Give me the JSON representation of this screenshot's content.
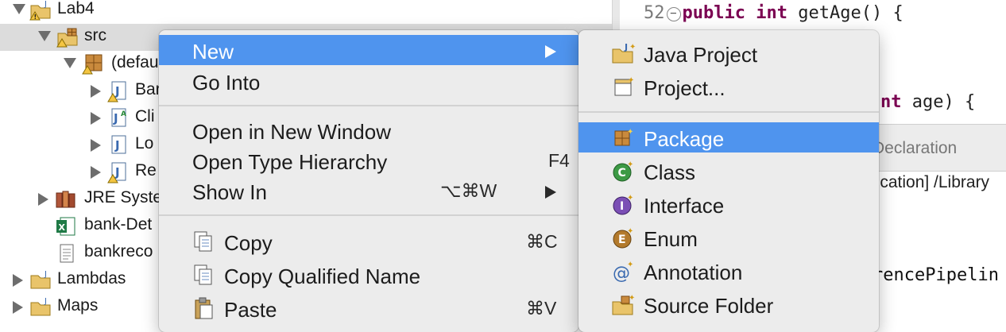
{
  "tree": {
    "items": [
      {
        "label": "Lab4"
      },
      {
        "label": "src"
      },
      {
        "label": "(defau"
      },
      {
        "label": "Bar"
      },
      {
        "label": "Cli"
      },
      {
        "label": "Lo"
      },
      {
        "label": "Re"
      },
      {
        "label": "JRE Syste"
      },
      {
        "label": "bank-Det"
      },
      {
        "label": "bankreco"
      },
      {
        "label": "Lambdas"
      },
      {
        "label": "Maps"
      }
    ]
  },
  "editor": {
    "line_number": "52",
    "line1_kw1": "public",
    "line1_kw2": "int",
    "line1_rest": "getAge() {",
    "line2_kw": "nt",
    "line2_rest": "age) {",
    "declaration_tab": "Declaration",
    "console_line": "lication] /Library",
    "code_fragment": "rencePipelin"
  },
  "context_menu": {
    "new_label": "New",
    "go_into_label": "Go Into",
    "open_new_window_label": "Open in New Window",
    "open_type_hierarchy_label": "Open Type Hierarchy",
    "open_type_hierarchy_shortcut": "F4",
    "show_in_label": "Show In",
    "show_in_shortcut": "⌥⌘W",
    "copy_label": "Copy",
    "copy_shortcut": "⌘C",
    "copy_qualified_label": "Copy Qualified Name",
    "paste_label": "Paste",
    "paste_shortcut": "⌘V"
  },
  "submenu": {
    "java_project_label": "Java Project",
    "project_label": "Project...",
    "package_label": "Package",
    "class_label": "Class",
    "interface_label": "Interface",
    "enum_label": "Enum",
    "annotation_label": "Annotation",
    "source_folder_label": "Source Folder"
  },
  "colors": {
    "highlight": "#4f94ee",
    "keyword": "#7b0052",
    "selected_row": "#dcdcdc"
  },
  "icons": {
    "project": "java-project-icon",
    "package": "package-icon",
    "java_file": "java-file-icon",
    "library": "library-icon",
    "excel": "excel-icon",
    "text_file": "text-file-icon",
    "class": "class-icon",
    "interface": "interface-icon",
    "enum": "enum-icon",
    "annotation": "annotation-icon",
    "copy": "copy-icon",
    "paste": "paste-icon"
  }
}
